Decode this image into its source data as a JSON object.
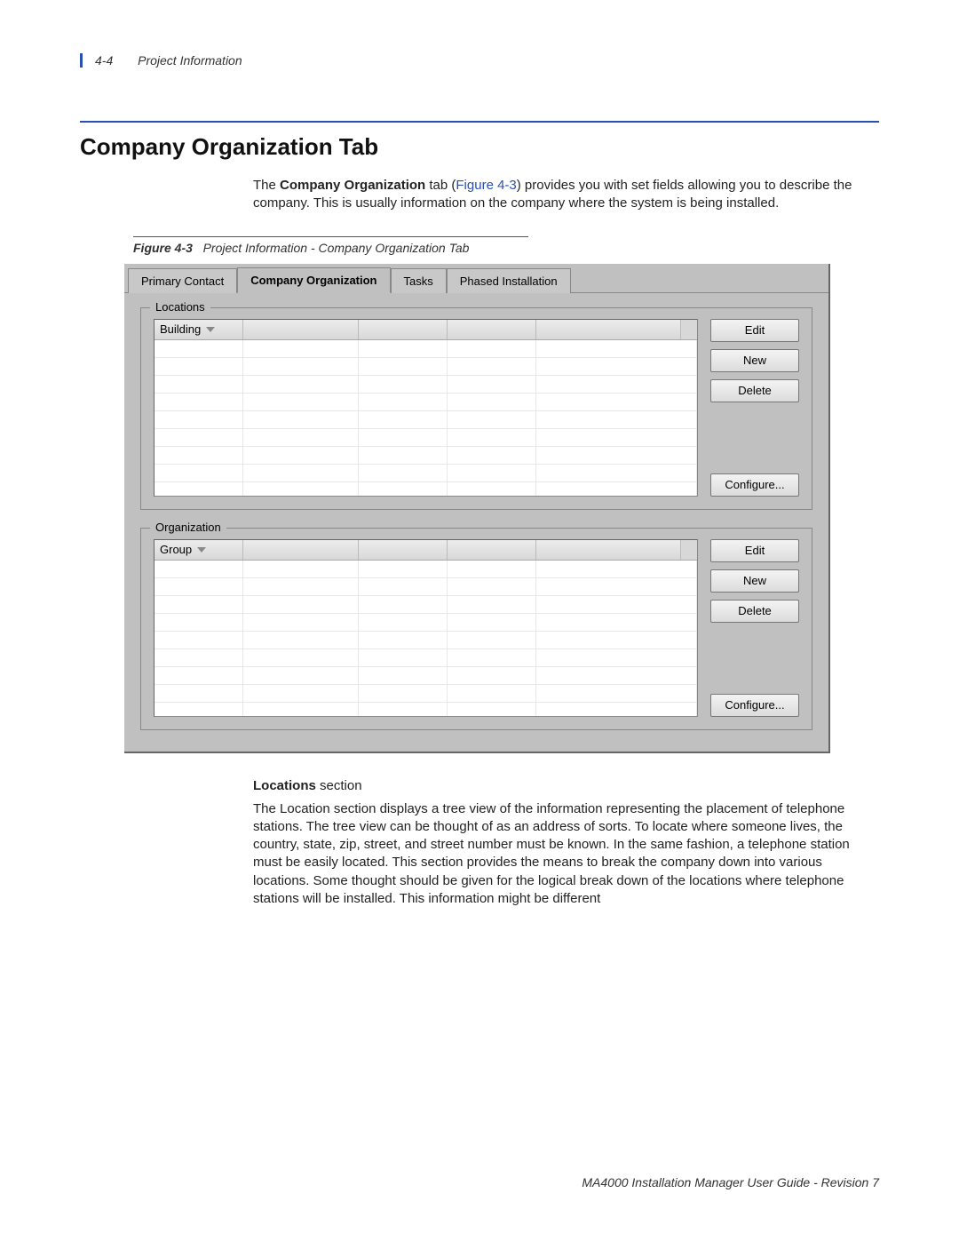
{
  "header": {
    "page_number": "4-4",
    "section": "Project Information"
  },
  "title": "Company Organization Tab",
  "intro": {
    "pre": "The ",
    "bold": "Company Organization",
    "mid": " tab (",
    "figref": "Figure 4-3",
    "post": ") provides you with set fields allowing you to describe the company. This is usually information on the company where the system is being installed."
  },
  "figure": {
    "label": "Figure 4-3",
    "caption": "Project Information - Company Organization Tab"
  },
  "app": {
    "tabs": [
      {
        "label": "Primary Contact",
        "active": false
      },
      {
        "label": "Company Organization",
        "active": true
      },
      {
        "label": "Tasks",
        "active": false
      },
      {
        "label": "Phased Installation",
        "active": false
      }
    ],
    "locations": {
      "legend": "Locations",
      "col1": "Building",
      "buttons": {
        "edit": "Edit",
        "new": "New",
        "delete": "Delete",
        "configure": "Configure..."
      }
    },
    "organization": {
      "legend": "Organization",
      "col1": "Group",
      "buttons": {
        "edit": "Edit",
        "new": "New",
        "delete": "Delete",
        "configure": "Configure..."
      }
    }
  },
  "subhead": {
    "bold": "Locations",
    "rest": " section"
  },
  "body_para": "The Location section displays a tree view of the information representing the placement of telephone stations. The tree view can be thought of as an address of sorts. To locate where someone lives, the country, state, zip, street, and street number must be known. In the same fashion, a telephone station must be easily located. This section provides the means to break the company down into various locations. Some thought should be given for the logical break down of the locations where telephone stations will be installed. This information might be different",
  "footer": "MA4000 Installation Manager User Guide - Revision 7"
}
